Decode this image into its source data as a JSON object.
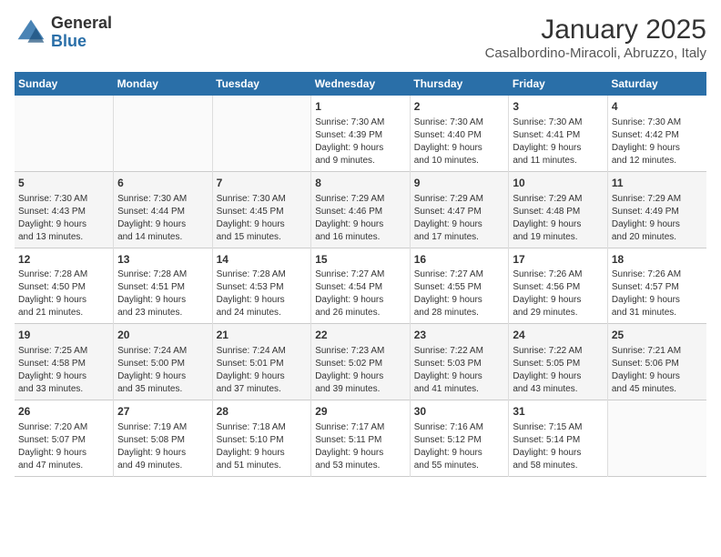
{
  "header": {
    "logo_line1": "General",
    "logo_line2": "Blue",
    "title": "January 2025",
    "subtitle": "Casalbordino-Miracoli, Abruzzo, Italy"
  },
  "days_of_week": [
    "Sunday",
    "Monday",
    "Tuesday",
    "Wednesday",
    "Thursday",
    "Friday",
    "Saturday"
  ],
  "weeks": [
    [
      {
        "day": "",
        "info": ""
      },
      {
        "day": "",
        "info": ""
      },
      {
        "day": "",
        "info": ""
      },
      {
        "day": "1",
        "info": "Sunrise: 7:30 AM\nSunset: 4:39 PM\nDaylight: 9 hours\nand 9 minutes."
      },
      {
        "day": "2",
        "info": "Sunrise: 7:30 AM\nSunset: 4:40 PM\nDaylight: 9 hours\nand 10 minutes."
      },
      {
        "day": "3",
        "info": "Sunrise: 7:30 AM\nSunset: 4:41 PM\nDaylight: 9 hours\nand 11 minutes."
      },
      {
        "day": "4",
        "info": "Sunrise: 7:30 AM\nSunset: 4:42 PM\nDaylight: 9 hours\nand 12 minutes."
      }
    ],
    [
      {
        "day": "5",
        "info": "Sunrise: 7:30 AM\nSunset: 4:43 PM\nDaylight: 9 hours\nand 13 minutes."
      },
      {
        "day": "6",
        "info": "Sunrise: 7:30 AM\nSunset: 4:44 PM\nDaylight: 9 hours\nand 14 minutes."
      },
      {
        "day": "7",
        "info": "Sunrise: 7:30 AM\nSunset: 4:45 PM\nDaylight: 9 hours\nand 15 minutes."
      },
      {
        "day": "8",
        "info": "Sunrise: 7:29 AM\nSunset: 4:46 PM\nDaylight: 9 hours\nand 16 minutes."
      },
      {
        "day": "9",
        "info": "Sunrise: 7:29 AM\nSunset: 4:47 PM\nDaylight: 9 hours\nand 17 minutes."
      },
      {
        "day": "10",
        "info": "Sunrise: 7:29 AM\nSunset: 4:48 PM\nDaylight: 9 hours\nand 19 minutes."
      },
      {
        "day": "11",
        "info": "Sunrise: 7:29 AM\nSunset: 4:49 PM\nDaylight: 9 hours\nand 20 minutes."
      }
    ],
    [
      {
        "day": "12",
        "info": "Sunrise: 7:28 AM\nSunset: 4:50 PM\nDaylight: 9 hours\nand 21 minutes."
      },
      {
        "day": "13",
        "info": "Sunrise: 7:28 AM\nSunset: 4:51 PM\nDaylight: 9 hours\nand 23 minutes."
      },
      {
        "day": "14",
        "info": "Sunrise: 7:28 AM\nSunset: 4:53 PM\nDaylight: 9 hours\nand 24 minutes."
      },
      {
        "day": "15",
        "info": "Sunrise: 7:27 AM\nSunset: 4:54 PM\nDaylight: 9 hours\nand 26 minutes."
      },
      {
        "day": "16",
        "info": "Sunrise: 7:27 AM\nSunset: 4:55 PM\nDaylight: 9 hours\nand 28 minutes."
      },
      {
        "day": "17",
        "info": "Sunrise: 7:26 AM\nSunset: 4:56 PM\nDaylight: 9 hours\nand 29 minutes."
      },
      {
        "day": "18",
        "info": "Sunrise: 7:26 AM\nSunset: 4:57 PM\nDaylight: 9 hours\nand 31 minutes."
      }
    ],
    [
      {
        "day": "19",
        "info": "Sunrise: 7:25 AM\nSunset: 4:58 PM\nDaylight: 9 hours\nand 33 minutes."
      },
      {
        "day": "20",
        "info": "Sunrise: 7:24 AM\nSunset: 5:00 PM\nDaylight: 9 hours\nand 35 minutes."
      },
      {
        "day": "21",
        "info": "Sunrise: 7:24 AM\nSunset: 5:01 PM\nDaylight: 9 hours\nand 37 minutes."
      },
      {
        "day": "22",
        "info": "Sunrise: 7:23 AM\nSunset: 5:02 PM\nDaylight: 9 hours\nand 39 minutes."
      },
      {
        "day": "23",
        "info": "Sunrise: 7:22 AM\nSunset: 5:03 PM\nDaylight: 9 hours\nand 41 minutes."
      },
      {
        "day": "24",
        "info": "Sunrise: 7:22 AM\nSunset: 5:05 PM\nDaylight: 9 hours\nand 43 minutes."
      },
      {
        "day": "25",
        "info": "Sunrise: 7:21 AM\nSunset: 5:06 PM\nDaylight: 9 hours\nand 45 minutes."
      }
    ],
    [
      {
        "day": "26",
        "info": "Sunrise: 7:20 AM\nSunset: 5:07 PM\nDaylight: 9 hours\nand 47 minutes."
      },
      {
        "day": "27",
        "info": "Sunrise: 7:19 AM\nSunset: 5:08 PM\nDaylight: 9 hours\nand 49 minutes."
      },
      {
        "day": "28",
        "info": "Sunrise: 7:18 AM\nSunset: 5:10 PM\nDaylight: 9 hours\nand 51 minutes."
      },
      {
        "day": "29",
        "info": "Sunrise: 7:17 AM\nSunset: 5:11 PM\nDaylight: 9 hours\nand 53 minutes."
      },
      {
        "day": "30",
        "info": "Sunrise: 7:16 AM\nSunset: 5:12 PM\nDaylight: 9 hours\nand 55 minutes."
      },
      {
        "day": "31",
        "info": "Sunrise: 7:15 AM\nSunset: 5:14 PM\nDaylight: 9 hours\nand 58 minutes."
      },
      {
        "day": "",
        "info": ""
      }
    ]
  ]
}
